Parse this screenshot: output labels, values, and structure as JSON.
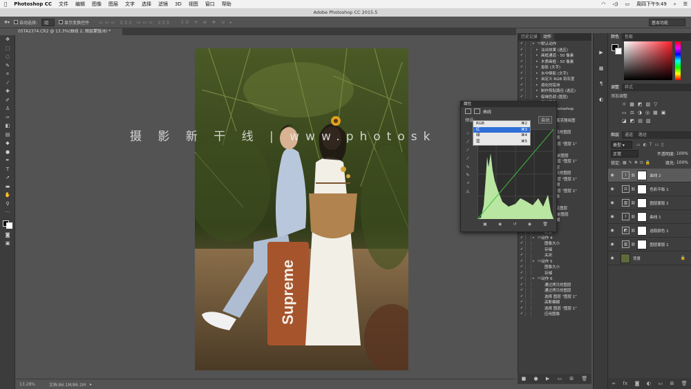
{
  "menubar": {
    "app": "Photoshop CC",
    "items": [
      "文件",
      "编辑",
      "图像",
      "图层",
      "文字",
      "选择",
      "滤镜",
      "3D",
      "视图",
      "窗口",
      "帮助"
    ],
    "clock": "周四下午9:49"
  },
  "window": {
    "title": "Adobe Photoshop CC 2015.5"
  },
  "options": {
    "auto_select_label": "自动选择:",
    "auto_select_value": "组",
    "show_transform_label": "显示变换控件",
    "workspace": "基本功能"
  },
  "document": {
    "tab": "05TA2374.CR2 @ 13.3%(曲线 2, 图层蒙版/8) *",
    "zoom": "13.28%",
    "docsize": "文档:86.1M/86.1M"
  },
  "watermark": "摄 影 新 干 线 | www.photosk",
  "photo_text": {
    "suitcase": "Supreme"
  },
  "actions_panel": {
    "tabs": [
      "历史记录",
      "动作"
    ],
    "rows": [
      {
        "t": "默认动作",
        "lvl": 0
      },
      {
        "t": "淡出效果 (选区)",
        "lvl": 1
      },
      {
        "t": "画框通道 - 50 像素",
        "lvl": 1
      },
      {
        "t": "木质画框 - 50 像素",
        "lvl": 1
      },
      {
        "t": "投影 (文字)",
        "lvl": 1
      },
      {
        "t": "水中倒影 (文字)",
        "lvl": 1
      },
      {
        "t": "自定义 RGB 到灰度",
        "lvl": 1
      },
      {
        "t": "熔化的铅块",
        "lvl": 1
      },
      {
        "t": "制作剪贴路径 (选区)",
        "lvl": 1
      },
      {
        "t": "棕褐色调 (图层)",
        "lvl": 1
      },
      {
        "t": "四分颜色",
        "lvl": 1
      },
      {
        "t": "存储为 Photoshop",
        "lvl": 1
      },
      {
        "t": "渐变映射",
        "lvl": 1
      },
      {
        "t": "混合器画笔克隆绘图",
        "lvl": 1
      },
      {
        "t": "动作 1",
        "lvl": 0
      },
      {
        "t": "通过拷贝的图层",
        "lvl": 2
      },
      {
        "t": "建立快照",
        "lvl": 2
      },
      {
        "t": "选择 图层 \"图层 1\"",
        "lvl": 2
      },
      {
        "t": "图层 1",
        "lvl": 2
      },
      {
        "t": "设置 当前图层",
        "lvl": 2
      },
      {
        "t": "选择 图层 \"图层 1\"",
        "lvl": 2
      },
      {
        "t": "复制图层",
        "lvl": 2
      },
      {
        "t": "通过拷贝的图层",
        "lvl": 2
      },
      {
        "t": "选择 图层 \"图层 1\"",
        "lvl": 2
      },
      {
        "t": "高斯模糊",
        "lvl": 2
      },
      {
        "t": "选择 图层 \"图层 1\"",
        "lvl": 2
      },
      {
        "t": "应用图像",
        "lvl": 2
      },
      {
        "t": "动作 3",
        "lvl": 0
      },
      {
        "t": "合并可见图层",
        "lvl": 2
      },
      {
        "t": "设置 当前图层",
        "lvl": 2
      },
      {
        "t": "高斯模糊",
        "lvl": 2
      },
      {
        "t": "去色",
        "lvl": 2
      },
      {
        "t": "建立",
        "lvl": 2
      },
      {
        "t": "动作 4",
        "lvl": 0
      },
      {
        "t": "图像大小",
        "lvl": 2
      },
      {
        "t": "存储",
        "lvl": 2
      },
      {
        "t": "关闭",
        "lvl": 2
      },
      {
        "t": "动作 5",
        "lvl": 0
      },
      {
        "t": "图像大小",
        "lvl": 2
      },
      {
        "t": "存储",
        "lvl": 2
      },
      {
        "t": "动作 6",
        "lvl": 0
      },
      {
        "t": "通过拷贝的图层",
        "lvl": 2
      },
      {
        "t": "通过拷贝的图层",
        "lvl": 2
      },
      {
        "t": "选择 图层 \"图层 1\"",
        "lvl": 2
      },
      {
        "t": "高斯模糊",
        "lvl": 2
      },
      {
        "t": "选择 图层 \"图层 1\"",
        "lvl": 2
      },
      {
        "t": "应用图像",
        "lvl": 2
      }
    ]
  },
  "properties": {
    "title": "属性",
    "label": "曲线",
    "preset_label": "预设:",
    "auto": "自动",
    "channels": [
      {
        "name": "RGB",
        "key": "⌘2"
      },
      {
        "name": "红",
        "key": "⌘3"
      },
      {
        "name": "绿",
        "key": "⌘4"
      },
      {
        "name": "蓝",
        "key": "⌘5"
      }
    ]
  },
  "swatches_tabs": [
    "颜色",
    "色板"
  ],
  "adjust_tabs": [
    "调整",
    "样式"
  ],
  "adjust_label": "添加调整",
  "layers_panel": {
    "tabs": [
      "图层",
      "通道",
      "路径"
    ],
    "kind": "类型",
    "blend": "正常",
    "opacity_label": "不透明度:",
    "opacity": "100%",
    "lock_label": "锁定:",
    "fill_label": "填充:",
    "fill": "100%",
    "layers": [
      {
        "name": "曲线 2",
        "type": "curves",
        "sel": true
      },
      {
        "name": "色彩平衡 1",
        "type": "balance",
        "sel": false
      },
      {
        "name": "图层蒙版 2",
        "type": "levels",
        "sel": false
      },
      {
        "name": "曲线 1",
        "type": "curves",
        "sel": false
      },
      {
        "name": "选取颜色 1",
        "type": "selective",
        "sel": false
      },
      {
        "name": "图层蒙版 1",
        "type": "levels",
        "sel": false
      },
      {
        "name": "背景",
        "type": "bg",
        "sel": false
      }
    ]
  }
}
